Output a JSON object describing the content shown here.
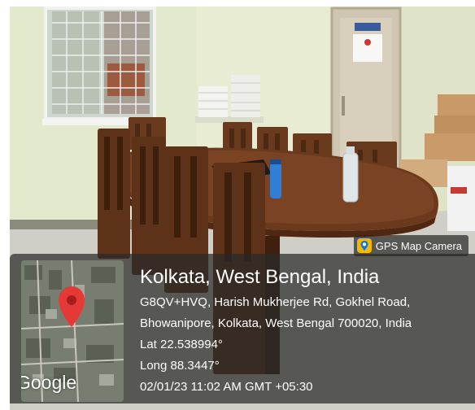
{
  "badge": {
    "icon": "map-pin-camera-icon",
    "label": "GPS Map Camera"
  },
  "location": {
    "title": "Kolkata, West Bengal, India",
    "address_line_1": "G8QV+HVQ, Harish Mukherjee Rd, Gokhel Road,",
    "address_line_2": "Bhowanipore, Kolkata, West Bengal 700020, India",
    "latitude": "Lat 22.538994°",
    "longitude": "Long 88.3447°",
    "timestamp": "02/01/23 11:02 AM GMT +05:30"
  },
  "map": {
    "icon": "location-pin-icon",
    "brand": "Google"
  },
  "colors": {
    "pin": "#e53935",
    "wall": "#e8edd3",
    "wood": "#5c3119",
    "overlay": "#282828"
  }
}
